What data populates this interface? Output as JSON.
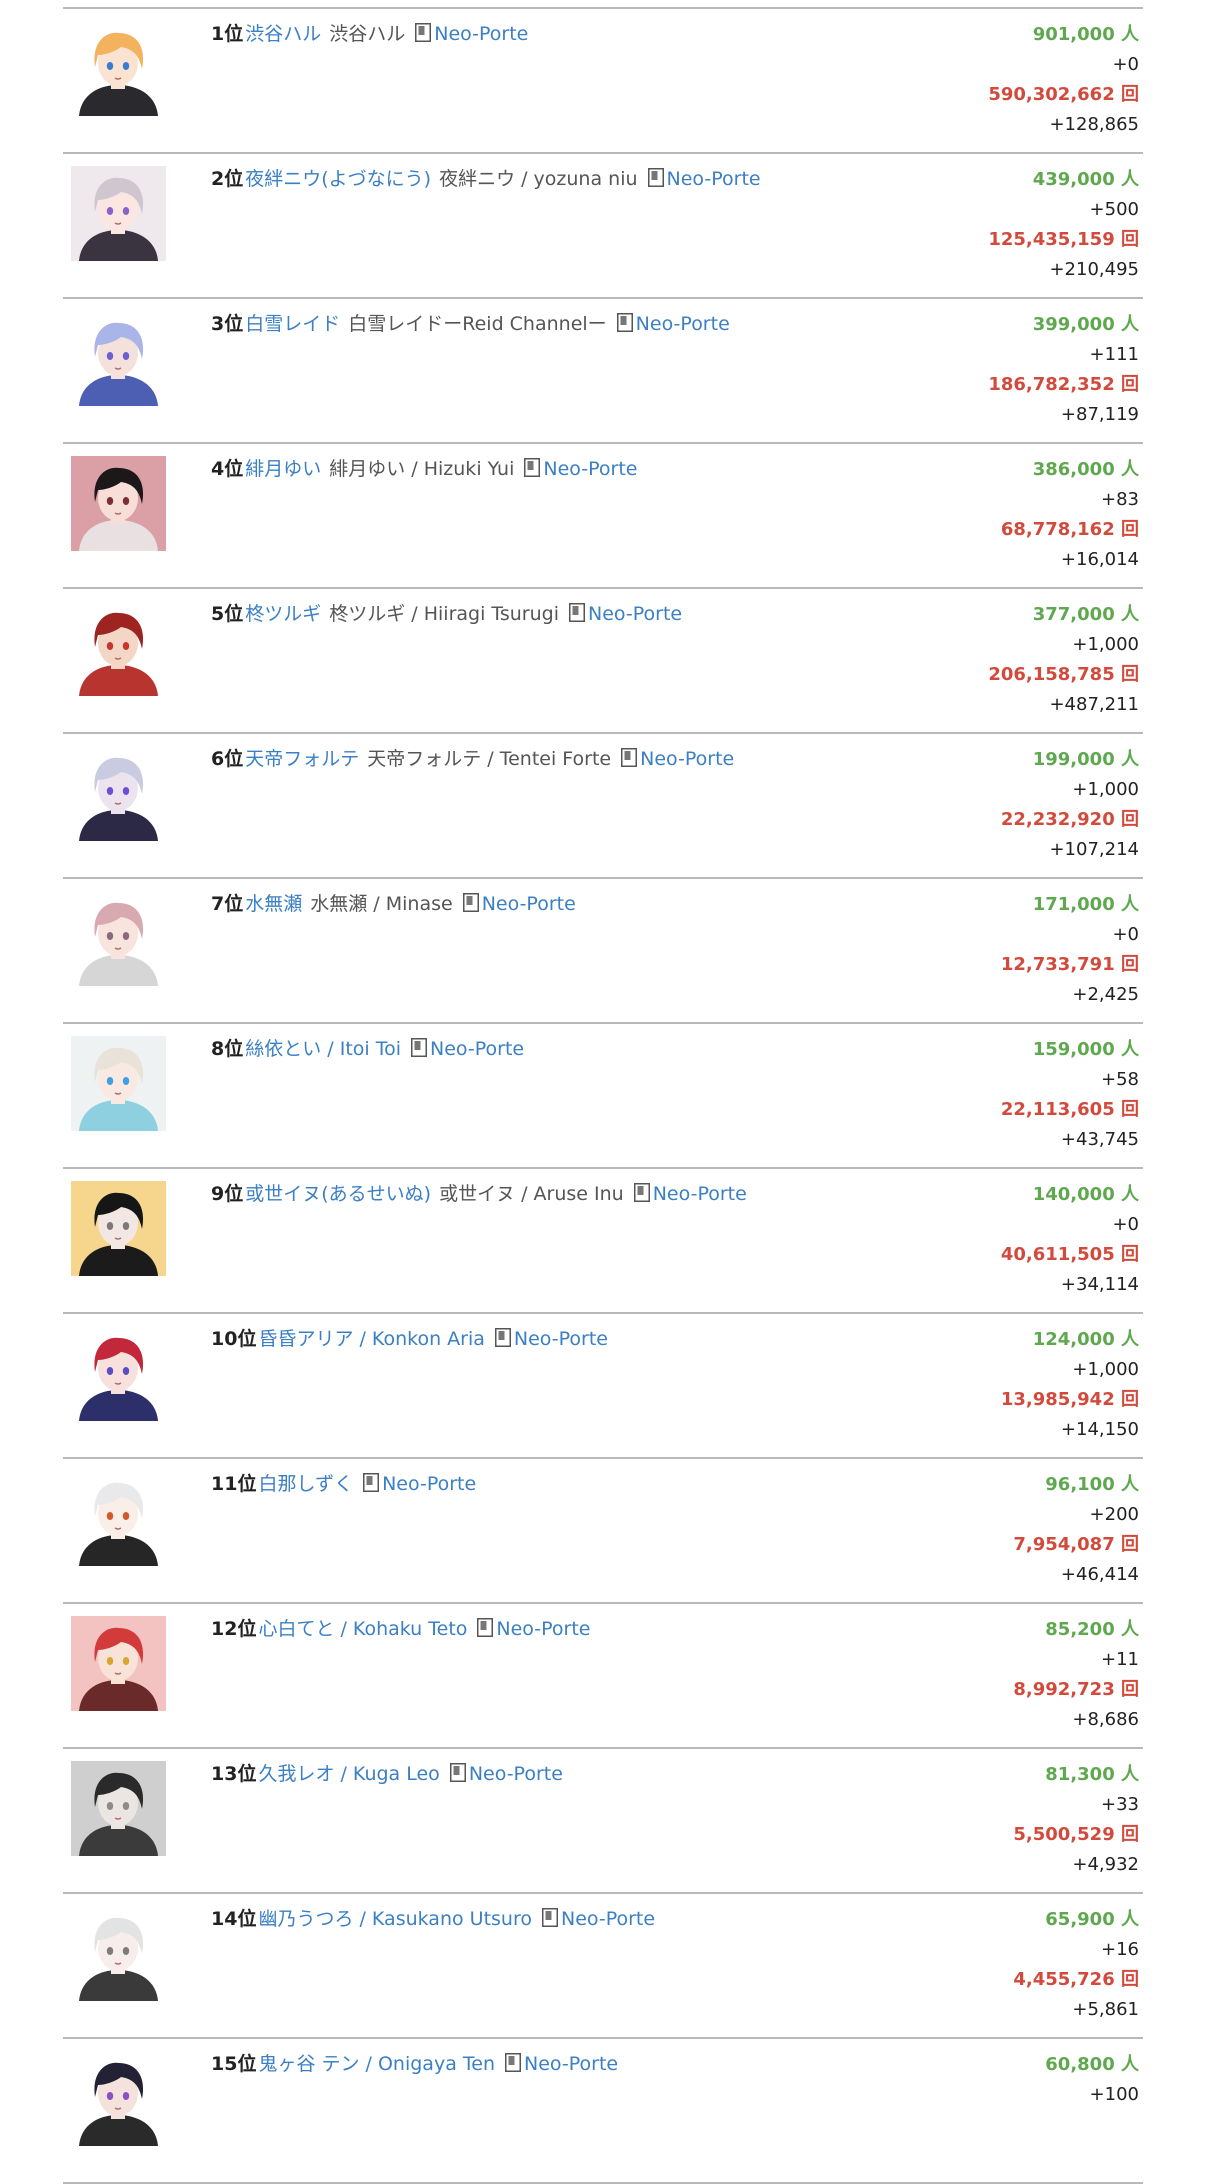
{
  "units": {
    "subscribers": "人",
    "views": "回"
  },
  "entries": [
    {
      "rank": "1位",
      "name": "渋谷ハル",
      "alias": "渋谷ハル",
      "office": "Neo-Porte",
      "subscribers": "901,000 人",
      "subscribers_delta": "+0",
      "views": "590,302,662 回",
      "views_delta": "+128,865",
      "avatar": {
        "bg": "#ffffff",
        "hair": "#f3b25e",
        "skin": "#fbe3d2",
        "clothes": "#2a2a2e",
        "eye": "#3a7bd0"
      }
    },
    {
      "rank": "2位",
      "name": "夜絆ニウ(よづなにう)",
      "alias": "夜絆ニウ / yozuna niu",
      "office": "Neo-Porte",
      "subscribers": "439,000 人",
      "subscribers_delta": "+500",
      "views": "125,435,159 回",
      "views_delta": "+210,495",
      "avatar": {
        "bg": "#efe9ee",
        "hair": "#cfc6cf",
        "skin": "#fbe6e2",
        "clothes": "#3a3340",
        "eye": "#8a63c9"
      }
    },
    {
      "rank": "3位",
      "name": "白雪レイド",
      "alias": "白雪レイドーReid Channelー",
      "office": "Neo-Porte",
      "subscribers": "399,000 人",
      "subscribers_delta": "+111",
      "views": "186,782,352 回",
      "views_delta": "+87,119",
      "avatar": {
        "bg": "#ffffff",
        "hair": "#a9b4e8",
        "skin": "#f4e1db",
        "clothes": "#4c5fb3",
        "eye": "#6a5ed0"
      }
    },
    {
      "rank": "4位",
      "name": "緋月ゆい",
      "alias": "緋月ゆい / Hizuki Yui",
      "office": "Neo-Porte",
      "subscribers": "386,000 人",
      "subscribers_delta": "+83",
      "views": "68,778,162 回",
      "views_delta": "+16,014",
      "avatar": {
        "bg": "#dba0a6",
        "hair": "#1c1718",
        "skin": "#f7dfd7",
        "clothes": "#e9e1e1",
        "eye": "#7a2f3a"
      }
    },
    {
      "rank": "5位",
      "name": "柊ツルギ",
      "alias": "柊ツルギ / Hiiragi Tsurugi",
      "office": "Neo-Porte",
      "subscribers": "377,000 人",
      "subscribers_delta": "+1,000",
      "views": "206,158,785 回",
      "views_delta": "+487,211",
      "avatar": {
        "bg": "#ffffff",
        "hair": "#9d2420",
        "skin": "#f3d6c5",
        "clothes": "#b8342f",
        "eye": "#c7362d"
      }
    },
    {
      "rank": "6位",
      "name": "天帝フォルテ",
      "alias": "天帝フォルテ / Tentei Forte",
      "office": "Neo-Porte",
      "subscribers": "199,000 人",
      "subscribers_delta": "+1,000",
      "views": "22,232,920 回",
      "views_delta": "+107,214",
      "avatar": {
        "bg": "#ffffff",
        "hair": "#c9cbe0",
        "skin": "#ebe4ee",
        "clothes": "#2c2946",
        "eye": "#6e4ed1"
      }
    },
    {
      "rank": "7位",
      "name": "水無瀬",
      "alias": "水無瀬 / Minase",
      "office": "Neo-Porte",
      "subscribers": "171,000 人",
      "subscribers_delta": "+0",
      "views": "12,733,791 回",
      "views_delta": "+2,425",
      "avatar": {
        "bg": "#ffffff",
        "hair": "#d9a9b1",
        "skin": "#f8e3dd",
        "clothes": "#d6d6d6",
        "eye": "#8a6a7c"
      }
    },
    {
      "rank": "8位",
      "name": "絲依とい / Itoi Toi",
      "alias": "",
      "office": "Neo-Porte",
      "subscribers": "159,000 人",
      "subscribers_delta": "+58",
      "views": "22,113,605 回",
      "views_delta": "+43,745",
      "avatar": {
        "bg": "#eef2f2",
        "hair": "#e8e2d8",
        "skin": "#f9e9e3",
        "clothes": "#8fd0e0",
        "eye": "#3f9fe0"
      }
    },
    {
      "rank": "9位",
      "name": "或世イヌ(あるせいぬ)",
      "alias": "或世イヌ / Aruse Inu",
      "office": "Neo-Porte",
      "subscribers": "140,000 人",
      "subscribers_delta": "+0",
      "views": "40,611,505 回",
      "views_delta": "+34,114",
      "avatar": {
        "bg": "#f6d68c",
        "hair": "#161616",
        "skin": "#f2e7e2",
        "clothes": "#1b1b1b",
        "eye": "#7a7a7a"
      }
    },
    {
      "rank": "10位",
      "name": "昏昏アリア / Konkon Aria",
      "alias": "",
      "office": "Neo-Porte",
      "subscribers": "124,000 人",
      "subscribers_delta": "+1,000",
      "views": "13,985,942 回",
      "views_delta": "+14,150",
      "avatar": {
        "bg": "#ffffff",
        "hair": "#c2273a",
        "skin": "#f8e1dc",
        "clothes": "#2d2f6b",
        "eye": "#5a4ec0"
      }
    },
    {
      "rank": "11位",
      "name": "白那しずく",
      "alias": "",
      "office": "Neo-Porte",
      "subscribers": "96,100 人",
      "subscribers_delta": "+200",
      "views": "7,954,087 回",
      "views_delta": "+46,414",
      "avatar": {
        "bg": "#ffffff",
        "hair": "#e9e9ec",
        "skin": "#faeee9",
        "clothes": "#262626",
        "eye": "#d05a2c"
      }
    },
    {
      "rank": "12位",
      "name": "心白てと / Kohaku Teto",
      "alias": "",
      "office": "Neo-Porte",
      "subscribers": "85,200 人",
      "subscribers_delta": "+11",
      "views": "8,992,723 回",
      "views_delta": "+8,686",
      "avatar": {
        "bg": "#f2c3c0",
        "hair": "#d33b3a",
        "skin": "#f9e3d9",
        "clothes": "#6b2a2a",
        "eye": "#d8a530"
      }
    },
    {
      "rank": "13位",
      "name": "久我レオ / Kuga Leo",
      "alias": "",
      "office": "Neo-Porte",
      "subscribers": "81,300 人",
      "subscribers_delta": "+33",
      "views": "5,500,529 回",
      "views_delta": "+4,932",
      "avatar": {
        "bg": "#cfcfcf",
        "hair": "#2a2a2a",
        "skin": "#ece6e3",
        "clothes": "#3b3b3b",
        "eye": "#8b8b8b"
      }
    },
    {
      "rank": "14位",
      "name": "幽乃うつろ / Kasukano Utsuro",
      "alias": "",
      "office": "Neo-Porte",
      "subscribers": "65,900 人",
      "subscribers_delta": "+16",
      "views": "4,455,726 回",
      "views_delta": "+5,861",
      "avatar": {
        "bg": "#ffffff",
        "hair": "#e3e3e3",
        "skin": "#f7eeeb",
        "clothes": "#3a3a3a",
        "eye": "#7c7c7c"
      }
    },
    {
      "rank": "15位",
      "name": "鬼ヶ谷 テン / Onigaya Ten",
      "alias": "",
      "office": "Neo-Porte",
      "subscribers": "60,800 人",
      "subscribers_delta": "+100",
      "views": "",
      "views_delta": "",
      "avatar": {
        "bg": "#ffffff",
        "hair": "#222234",
        "skin": "#f3e3dc",
        "clothes": "#2a2a2a",
        "eye": "#8a4ec7"
      }
    }
  ]
}
